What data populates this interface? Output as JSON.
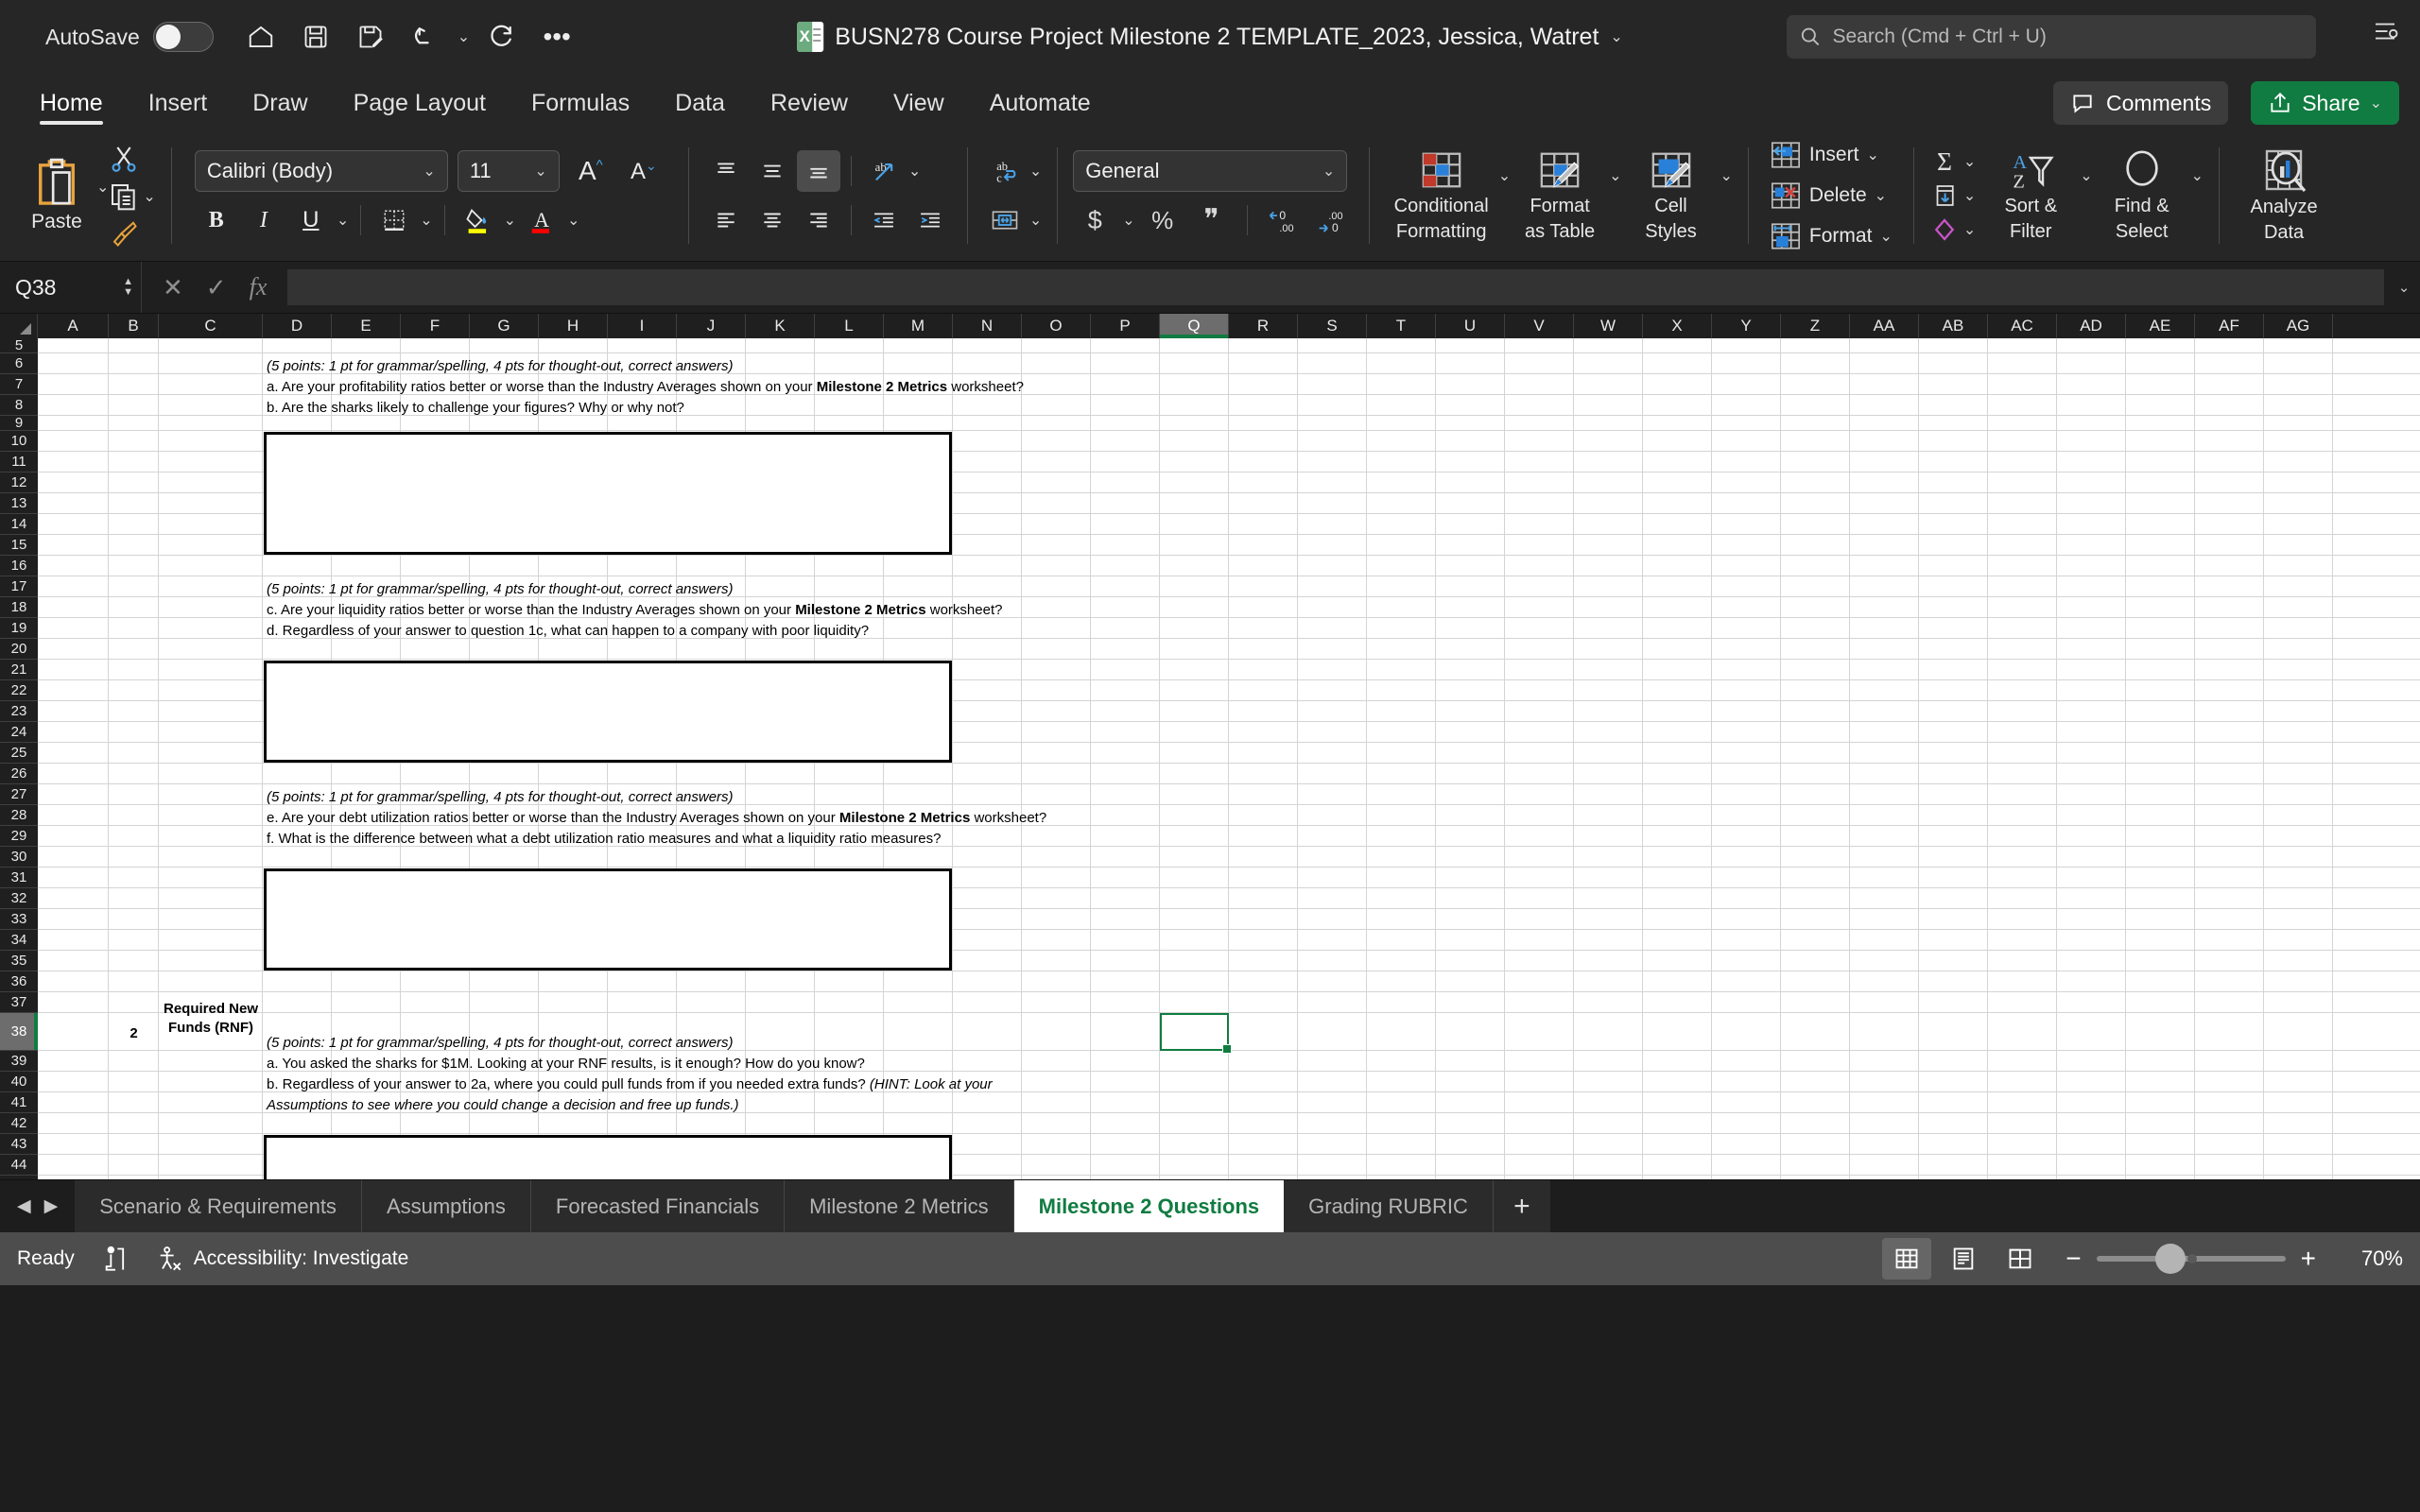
{
  "titlebar": {
    "autosave_label": "AutoSave",
    "autosave_state": "off",
    "doc_title": "BUSN278 Course Project Milestone 2 TEMPLATE_2023, Jessica, Watret",
    "title_caret": "⌄",
    "quick_access": [
      {
        "name": "home-icon",
        "glyph": "⌂"
      },
      {
        "name": "save-icon",
        "glyph": "🖫"
      },
      {
        "name": "save-as-icon",
        "glyph": "🖫"
      },
      {
        "name": "undo-icon",
        "glyph": "↶"
      },
      {
        "name": "redo-icon",
        "glyph": "↷"
      },
      {
        "name": "more-options-icon",
        "glyph": "•••"
      }
    ],
    "search_placeholder": "Search (Cmd + Ctrl + U)"
  },
  "ribbon_tabs": [
    {
      "label": "Home",
      "active": true
    },
    {
      "label": "Insert",
      "active": false
    },
    {
      "label": "Draw",
      "active": false
    },
    {
      "label": "Page Layout",
      "active": false
    },
    {
      "label": "Formulas",
      "active": false
    },
    {
      "label": "Data",
      "active": false
    },
    {
      "label": "Review",
      "active": false
    },
    {
      "label": "View",
      "active": false
    },
    {
      "label": "Automate",
      "active": false
    }
  ],
  "ribbon_right": {
    "comments_label": "Comments",
    "share_label": "Share"
  },
  "ribbon": {
    "paste_label": "Paste",
    "font_name": "Calibri (Body)",
    "font_size": "11",
    "number_format": "General",
    "conditional_formatting_label": "Conditional\nFormatting",
    "conditional_formatting_line1": "Conditional",
    "conditional_formatting_line2": "Formatting",
    "format_as_table_line1": "Format",
    "format_as_table_line2": "as Table",
    "cell_styles_line1": "Cell",
    "cell_styles_line2": "Styles",
    "insert_label": "Insert",
    "delete_label": "Delete",
    "format_label": "Format",
    "sort_filter_line1": "Sort &",
    "sort_filter_line2": "Filter",
    "find_select_line1": "Find &",
    "find_select_line2": "Select",
    "analyze_data_line1": "Analyze",
    "analyze_data_line2": "Data",
    "bold": "B",
    "italic": "I",
    "underline": "U",
    "currency": "$",
    "percent": "%",
    "comma": "❞",
    "accent_green": "#107c41",
    "highlight_yellow": "#ffff00",
    "font_color_red": "#ff0000"
  },
  "formula_bar": {
    "name_box": "Q38",
    "cancel_icon": "✕",
    "enter_icon": "✓",
    "function_icon": "fx",
    "formula_value": "",
    "expand_icon": "⌄"
  },
  "grid": {
    "selected_cell": "Q38",
    "selected_column": "Q",
    "selected_row": 38,
    "columns": [
      "A",
      "B",
      "C",
      "D",
      "E",
      "F",
      "G",
      "H",
      "I",
      "J",
      "K",
      "L",
      "M",
      "N",
      "O",
      "P",
      "Q",
      "R",
      "S",
      "T",
      "U",
      "V",
      "W",
      "X",
      "Y",
      "Z",
      "AA",
      "AB",
      "AC",
      "AD",
      "AE",
      "AF",
      "AG"
    ],
    "first_row": 5,
    "last_row": 53,
    "cells": [
      {
        "row": 6,
        "text": "(5 points: 1 pt for grammar/spelling, 4 pts for thought-out, correct answers)",
        "style": "italic"
      },
      {
        "row": 7,
        "text": "a. Are your profitability ratios better or worse than the Industry Averages shown on your ",
        "bold_part": "Milestone 2 Metrics",
        "tail": " worksheet?",
        "style": "normal"
      },
      {
        "row": 8,
        "text": "b. Are the sharks likely to challenge your figures? Why or why not?",
        "style": "normal"
      },
      {
        "row": 17,
        "text": "(5 points: 1 pt for grammar/spelling, 4 pts for thought-out, correct answers)",
        "style": "italic"
      },
      {
        "row": 18,
        "text": "c. Are your liquidity ratios better or worse than the Industry Averages shown on your ",
        "bold_part": "Milestone 2 Metrics",
        "tail": " worksheet?",
        "style": "normal"
      },
      {
        "row": 19,
        "text": "d. Regardless of your answer to question 1c, what can happen to a company with poor liquidity?",
        "style": "normal"
      },
      {
        "row": 27,
        "text": "(5 points: 1 pt for grammar/spelling, 4 pts for thought-out, correct answers)",
        "style": "italic"
      },
      {
        "row": 28,
        "text": "e. Are your debt utilization ratios better or worse than the Industry Averages shown on your ",
        "bold_part": "Milestone 2 Metrics",
        "tail": " worksheet?",
        "style": "normal"
      },
      {
        "row": 29,
        "text": "f. What is the difference between what a debt utilization ratio measures and what a liquidity ratio measures?",
        "style": "normal"
      },
      {
        "row": 38,
        "col": "B",
        "text": "2",
        "style": "bold"
      },
      {
        "row": 38,
        "col": "C",
        "text": "Required New",
        "text2": "Funds (RNF)",
        "style": "bold"
      },
      {
        "row": 38,
        "text": "(5 points: 1 pt for grammar/spelling, 4 pts for thought-out, correct answers)",
        "style": "italic"
      },
      {
        "row": 39,
        "text": "a. You asked the sharks for $1M.  Looking at your RNF results, is it enough?  How do you know?",
        "style": "normal"
      },
      {
        "row": 40,
        "text": "b. Regardless of your answer to 2a, where you could pull funds from if you needed extra funds?  ",
        "italic_part": "(HINT:  Look at your",
        "style": "normal"
      },
      {
        "row": 41,
        "text": "Assumptions to see where you could change a decision and free up funds.)",
        "style": "italic"
      }
    ],
    "answer_boxes": [
      {
        "from_row": 10,
        "to_row": 15
      },
      {
        "from_row": 21,
        "to_row": 25
      },
      {
        "from_row": 31,
        "to_row": 35
      },
      {
        "from_row": 43,
        "to_row": 52
      }
    ]
  },
  "sheet_tabs": {
    "nav_prev": "◀",
    "nav_next": "▶",
    "tabs": [
      {
        "label": "Scenario & Requirements",
        "active": false
      },
      {
        "label": "Assumptions",
        "active": false
      },
      {
        "label": "Forecasted Financials",
        "active": false
      },
      {
        "label": "Milestone 2 Metrics",
        "active": false
      },
      {
        "label": "Milestone 2 Questions",
        "active": true
      },
      {
        "label": "Grading RUBRIC",
        "active": false
      }
    ],
    "add_sheet": "+"
  },
  "status_bar": {
    "status": "Ready",
    "accessibility": "Accessibility: Investigate",
    "zoom_out": "−",
    "zoom_in": "+",
    "zoom_level": "70%",
    "views": [
      "normal-view",
      "page-layout-view",
      "page-break-view"
    ]
  }
}
